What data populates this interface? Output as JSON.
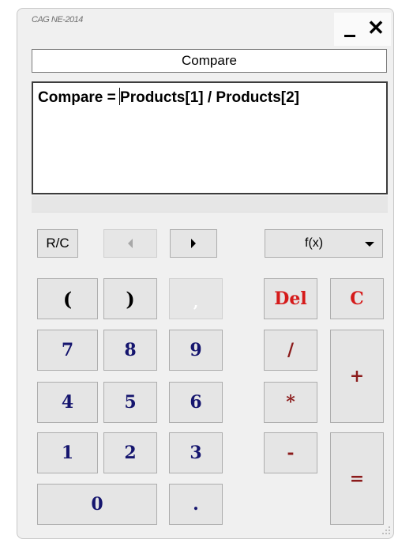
{
  "window": {
    "title": "CAG NE-2014",
    "minimize_icon": "minimize-icon",
    "close_label": "✕"
  },
  "formula": {
    "name": "Compare",
    "expression_before_caret": "Compare = ",
    "expression_after_caret": "Products[1] / Products[2]"
  },
  "toolbar": {
    "recall_label": "R/C",
    "cursor_left_icon": "triangle-left-icon",
    "cursor_right_icon": "triangle-right-icon",
    "function_label": "f(x)",
    "function_dropdown_icon": "chevron-down-icon"
  },
  "keys": {
    "open_paren": "(",
    "close_paren": ")",
    "comma": ",",
    "del": "Del",
    "clear": "C",
    "seven": "7",
    "eight": "8",
    "nine": "9",
    "four": "4",
    "five": "5",
    "six": "6",
    "one": "1",
    "two": "2",
    "three": "3",
    "zero": "0",
    "dot": ".",
    "divide": "/",
    "multiply": "*",
    "minus": "-",
    "plus": "+",
    "equals": "="
  },
  "colors": {
    "digit": "#15156e",
    "action": "#d51a1a",
    "operator": "#8b1a1a"
  }
}
